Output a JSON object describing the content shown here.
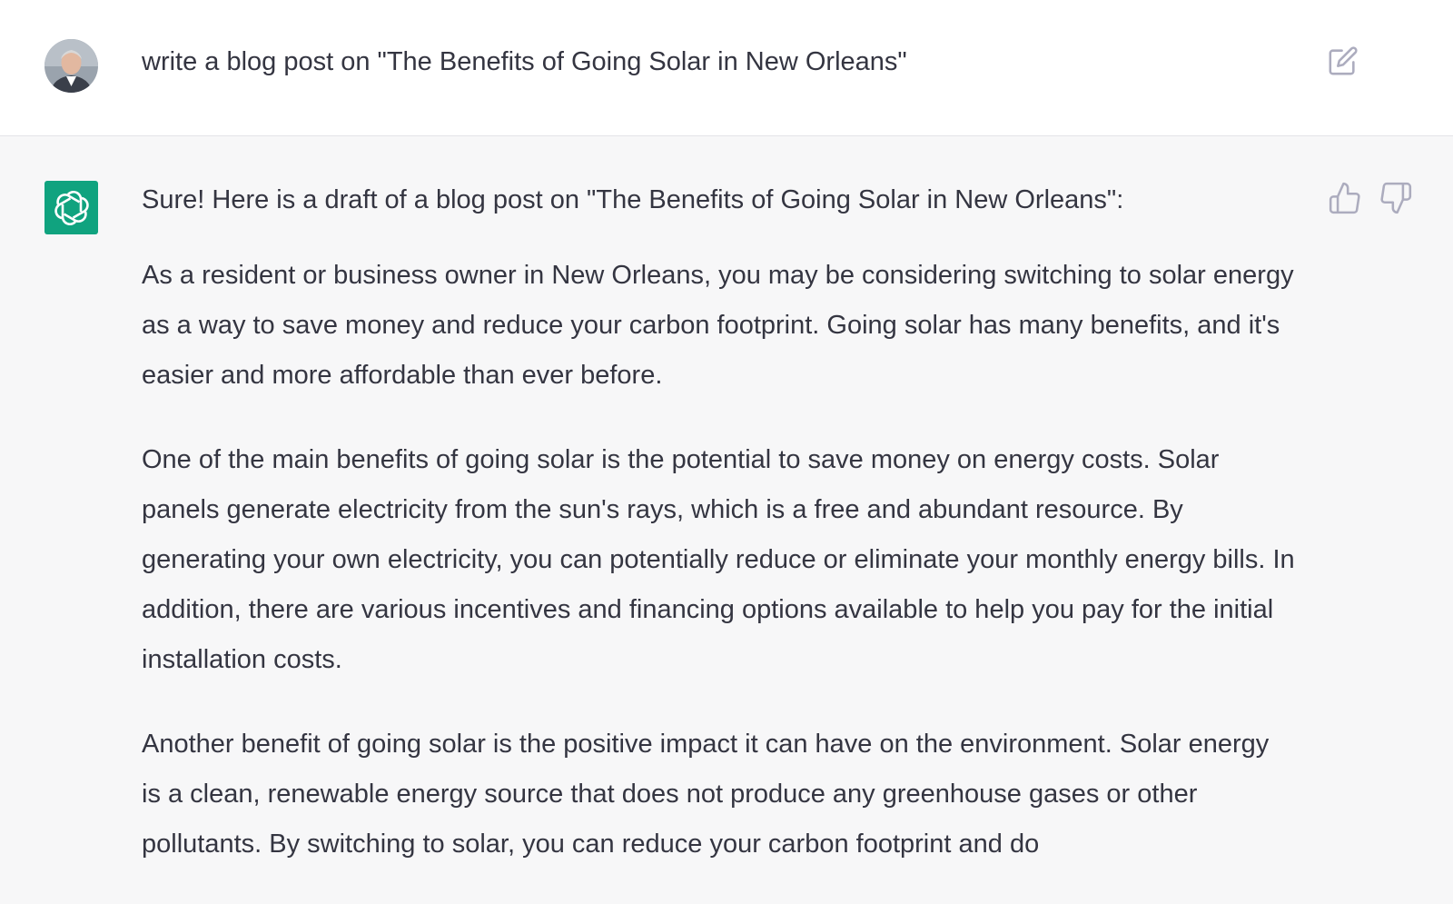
{
  "user_message": {
    "text": "write a blog post on \"The Benefits of Going Solar in New Orleans\""
  },
  "assistant_message": {
    "intro": "Sure! Here is a draft of a blog post on \"The Benefits of Going Solar in New Orleans\":",
    "paragraphs": [
      "As a resident or business owner in New Orleans, you may be considering switching to solar energy as a way to save money and reduce your carbon footprint. Going solar has many benefits, and it's easier and more affordable than ever before.",
      "One of the main benefits of going solar is the potential to save money on energy costs. Solar panels generate electricity from the sun's rays, which is a free and abundant resource. By generating your own electricity, you can potentially reduce or eliminate your monthly energy bills. In addition, there are various incentives and financing options available to help you pay for the initial installation costs.",
      "Another benefit of going solar is the positive impact it can have on the environment. Solar energy is a clean, renewable energy source that does not produce any greenhouse gases or other pollutants. By switching to solar, you can reduce your carbon footprint and do"
    ]
  },
  "icons": {
    "avatar": "user-avatar",
    "edit": "edit-icon",
    "logo": "openai-logo-icon",
    "thumbs_up": "thumbs-up-icon",
    "thumbs_down": "thumbs-down-icon"
  },
  "colors": {
    "brand": "#10a37f",
    "text": "#343541",
    "assistant_bg": "#f7f7f8",
    "user_bg": "#ffffff",
    "icon": "#acacbe"
  }
}
